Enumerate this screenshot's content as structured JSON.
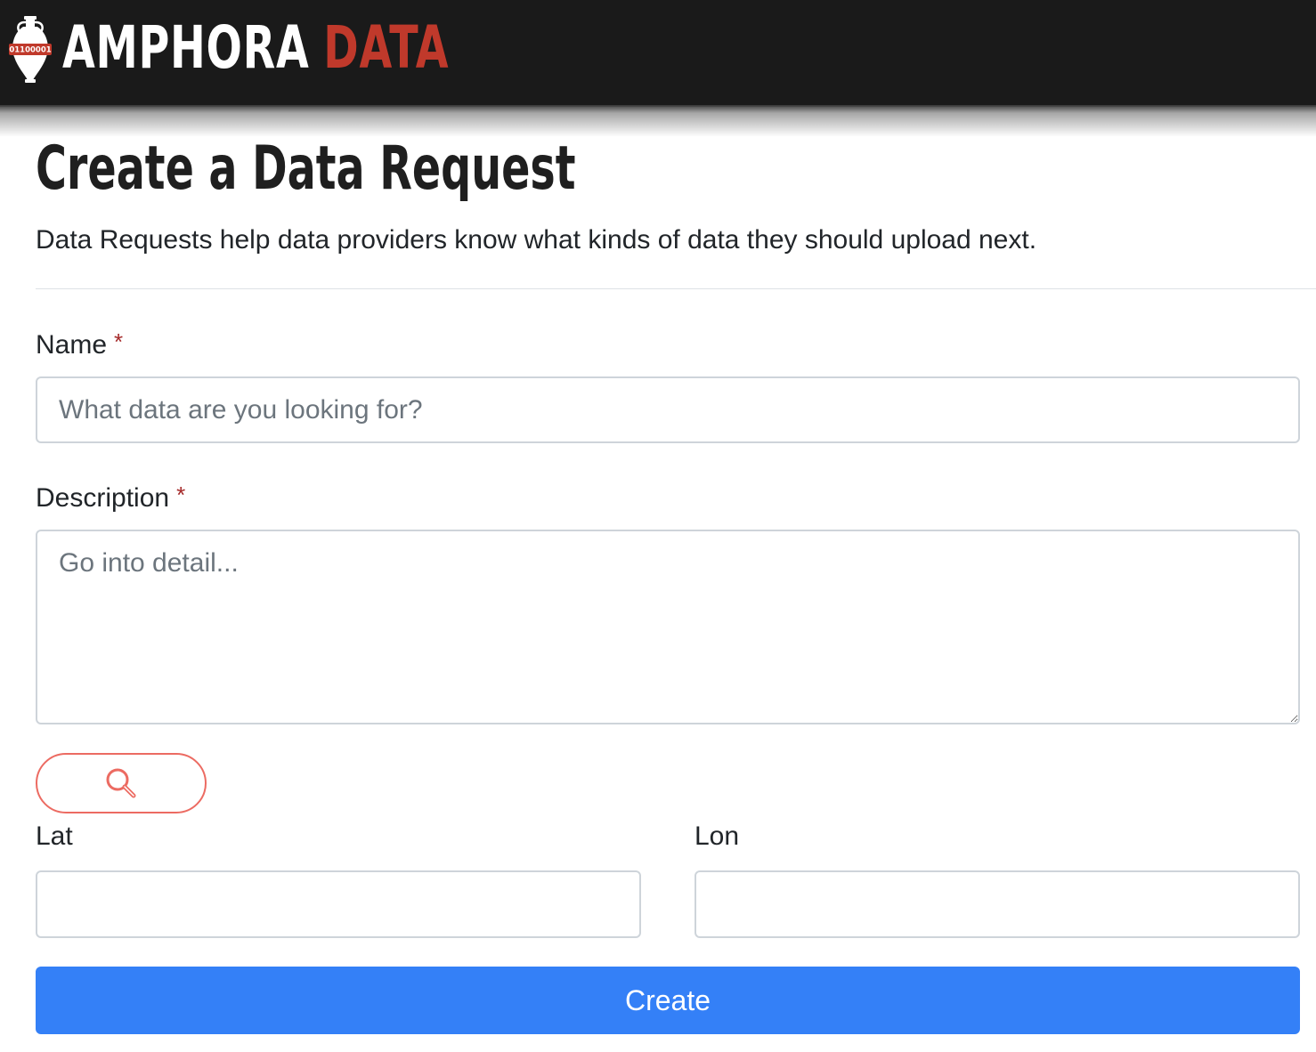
{
  "brand": {
    "logo_badge_text": "01100001",
    "name_primary": "AMPHORA",
    "name_accent": "DATA",
    "accent_color": "#c0392b"
  },
  "page": {
    "title": "Create a Data Request",
    "subtitle": "Data Requests help data providers know what kinds of data they should upload next."
  },
  "form": {
    "name": {
      "label": "Name",
      "required_mark": "*",
      "value": "",
      "placeholder": "What data are you looking for?"
    },
    "description": {
      "label": "Description",
      "required_mark": "*",
      "value": "",
      "placeholder": "Go into detail..."
    },
    "location_search": {
      "icon": "search-icon",
      "color": "#ec6b62"
    },
    "lat": {
      "label": "Lat",
      "value": ""
    },
    "lon": {
      "label": "Lon",
      "value": ""
    },
    "submit_label": "Create",
    "submit_color": "#3480f7"
  }
}
